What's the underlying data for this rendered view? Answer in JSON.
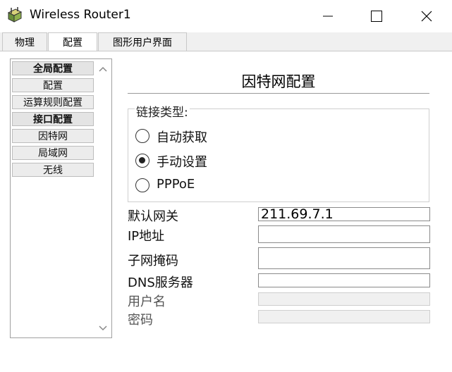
{
  "window": {
    "title": "Wireless Router1"
  },
  "tabs": [
    {
      "label": "物理"
    },
    {
      "label": "配置"
    },
    {
      "label": "图形用户界面"
    }
  ],
  "sidebar": {
    "items": [
      {
        "label": "全局配置",
        "type": "header"
      },
      {
        "label": "配置"
      },
      {
        "label": "运算规则配置"
      },
      {
        "label": "接口配置",
        "type": "header"
      },
      {
        "label": "因特网"
      },
      {
        "label": "局域网"
      },
      {
        "label": "无线"
      }
    ]
  },
  "panel": {
    "title": "因特网配置",
    "connection_type_legend": "链接类型:",
    "radio_options": [
      {
        "label": "自动获取",
        "selected": false
      },
      {
        "label": "手动设置",
        "selected": true
      },
      {
        "label": "PPPoE",
        "selected": false
      }
    ],
    "fields": {
      "gateway": {
        "label": "默认网关",
        "value": "211.69.7.1"
      },
      "ip": {
        "label": "IP地址",
        "value": ""
      },
      "subnet": {
        "label": "子网掩码",
        "value": ""
      },
      "dns": {
        "label": "DNS服务器",
        "value": ""
      },
      "username": {
        "label": "用户名",
        "value": ""
      },
      "password": {
        "label": "密码",
        "value": ""
      }
    }
  }
}
